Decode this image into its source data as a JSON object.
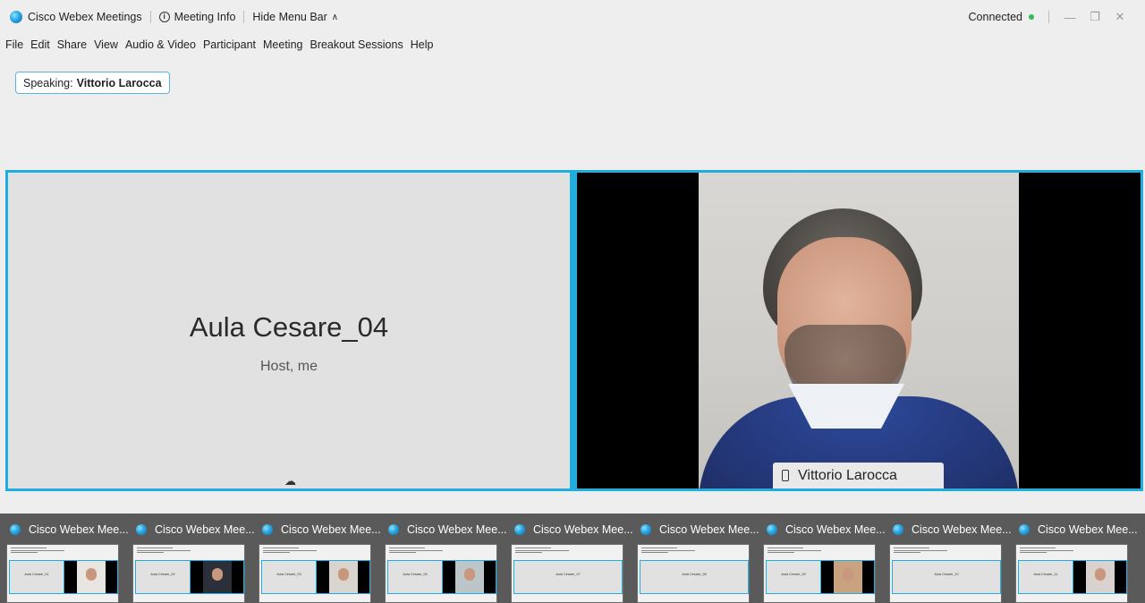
{
  "titlebar": {
    "app_name": "Cisco Webex Meetings",
    "meeting_info": "Meeting Info",
    "hide_menu_bar": "Hide Menu Bar",
    "status": "Connected"
  },
  "menu": [
    "File",
    "Edit",
    "Share",
    "View",
    "Audio & Video",
    "Participant",
    "Meeting",
    "Breakout Sessions",
    "Help"
  ],
  "speaking": {
    "prefix": "Speaking:",
    "name": "Vittorio Larocca"
  },
  "stage": {
    "left_tile": {
      "name": "Aula Cesare_04",
      "role": "Host, me"
    },
    "right_tile": {
      "name": "Vittorio Larocca"
    }
  },
  "taskbar": {
    "window_title": "Cisco Webex Mee...",
    "thumbnails": [
      {
        "room": "Aula Cesare_01",
        "has_video": true,
        "video_bg": "#e9e6e1"
      },
      {
        "room": "Aula Cesare_02",
        "has_video": true,
        "video_bg": "#2b2f3a"
      },
      {
        "room": "Aula Cesare_03",
        "has_video": true,
        "video_bg": "#d9d4cd"
      },
      {
        "room": "Aula Cesare_04",
        "has_video": true,
        "video_bg": "#bcc6c9"
      },
      {
        "room": "Aula Cesare_07",
        "has_video": false
      },
      {
        "room": "Aula Cesare_08",
        "has_video": false
      },
      {
        "room": "Aula Cesare_09",
        "has_video": true,
        "video_bg": "#c9a37f"
      },
      {
        "room": "Aula Cesare_10",
        "has_video": false
      },
      {
        "room": "Aula Cesare_11",
        "has_video": true,
        "video_bg": "#d9d2ce"
      }
    ]
  },
  "colors": {
    "accent": "#1eaee0",
    "status_green": "#2ebd59",
    "taskbar": "#5a5a5a"
  }
}
